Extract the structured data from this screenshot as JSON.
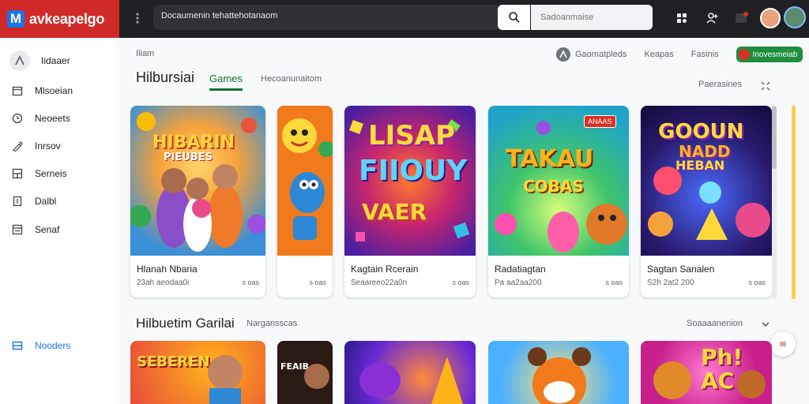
{
  "app": {
    "logo_letter": "M",
    "name": "avkeapelgo"
  },
  "topbar": {
    "search_value": "Docaumenin tehattehotanaom",
    "search_placeholder": "Sadoanmaise"
  },
  "sidebar": {
    "items": [
      {
        "label": "Iidaaer",
        "icon": "user-icon"
      },
      {
        "label": "Mlsoeian",
        "icon": "calendar-icon"
      },
      {
        "label": "Neoeets",
        "icon": "clock-icon"
      },
      {
        "label": "Inrsov",
        "icon": "brush-icon"
      },
      {
        "label": "Serneis",
        "icon": "grid-icon"
      },
      {
        "label": "Dalbl",
        "icon": "document-icon"
      },
      {
        "label": "Senaf",
        "icon": "storage-icon"
      }
    ],
    "bottom_item": {
      "label": "Nooders",
      "icon": "grid-icon"
    }
  },
  "main": {
    "breadcrumb": "Iliam",
    "top_links": {
      "link1": "Gaomatpleds",
      "link2": "Keapas",
      "link3": "Fasinis",
      "pill": "Inovesmeiab"
    },
    "section1": {
      "title": "Hilbursiai",
      "tab_active": "Games",
      "tab_inactive": "Hecoanunaitom",
      "right_link": "Paerasines"
    },
    "section2": {
      "title": "Hilbuetim Garilai",
      "subtitle": "Nargansscas",
      "right_link": "Soaaaanenion"
    },
    "cards": [
      {
        "title": "Hlanah Nbaria",
        "meta": "23ah aeodaa0i",
        "meta_r": "s oas",
        "art_line1": "HIBARIN",
        "art_line2": "PIEUBES"
      },
      {
        "title": "",
        "meta": "",
        "meta_r": "s oas",
        "art_line1": "",
        "art_line2": ""
      },
      {
        "title": "Kagtain Rcerain",
        "meta": "Seaareeo22a0n",
        "meta_r": "s oas",
        "art_line1": "LISAP",
        "art_line2": "FIIOUY",
        "art_line3": "VAER"
      },
      {
        "title": "Radatiagtan",
        "meta": "Pa aa2aa200",
        "meta_r": "s oas",
        "art_line1": "TAKAU",
        "art_line2": "COBAS",
        "badge": "ANAAS"
      },
      {
        "title": "Sagtan Sanalen",
        "meta": "S2h 2at2 200",
        "meta_r": "s oas",
        "art_line1": "GOOUN",
        "art_line2": "NADD",
        "art_line3": "HEBAN"
      }
    ],
    "row2_art": [
      {
        "text": "SEBEREN"
      },
      {
        "text": "FEAIB"
      },
      {
        "text": ""
      },
      {
        "text": ""
      },
      {
        "text": "Ph! AC"
      }
    ]
  },
  "colors": {
    "brand_red": "#cf2a27",
    "topbar_dark": "#202124",
    "accent_green": "#137333",
    "link_blue": "#1a73e8"
  }
}
